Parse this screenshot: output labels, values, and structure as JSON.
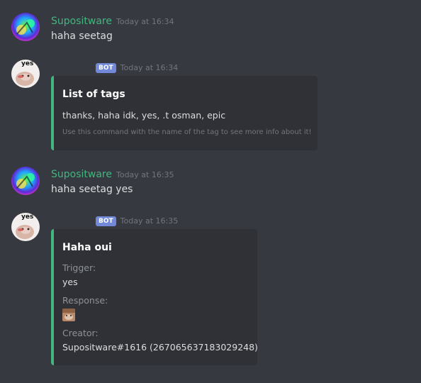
{
  "messages": [
    {
      "username": "Supositware",
      "timestamp": "Today at 16:34",
      "text": "haha seetag"
    },
    {
      "avatar_text": "yes",
      "bot_tag": "BOT",
      "timestamp": "Today at 16:34",
      "embed": {
        "title": "List of tags",
        "description": "thanks, haha idk, yes, .t osman, epic",
        "footer": "Use this command with the name of the tag to see more info about it!"
      }
    },
    {
      "username": "Supositware",
      "timestamp": "Today at 16:35",
      "text": "haha seetag yes"
    },
    {
      "avatar_text": "yes",
      "bot_tag": "BOT",
      "timestamp": "Today at 16:35",
      "embed": {
        "title": "Haha oui",
        "fields": [
          {
            "name": "Trigger:",
            "value": "yes"
          },
          {
            "name": "Response:",
            "value": ""
          },
          {
            "name": "Creator:",
            "value": "Supositware#1616 (267065637183029248)"
          }
        ]
      }
    }
  ],
  "colors": {
    "background": "#36393f",
    "embed_bg": "#2f3136",
    "embed_accent": "#43b581",
    "username": "#43b581",
    "bot_tag": "#7289da"
  }
}
